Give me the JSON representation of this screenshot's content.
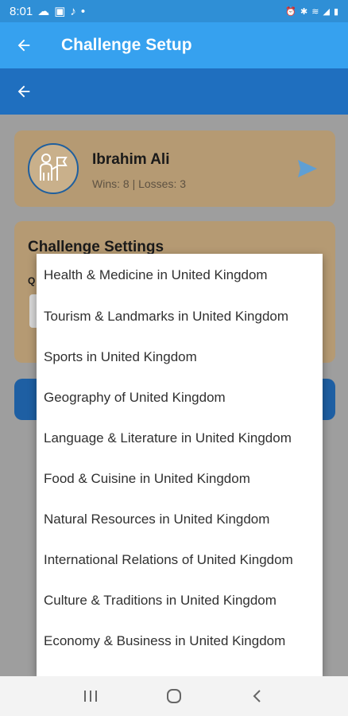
{
  "status": {
    "time": "8:01",
    "left_icons": [
      "cloud-icon",
      "image-icon",
      "music-icon",
      "dot-icon"
    ],
    "right_icons": [
      "alarm-icon",
      "bluetooth-icon",
      "wifi-icon",
      "signal-icon",
      "battery-icon"
    ]
  },
  "app_bar": {
    "title": "Challenge Setup"
  },
  "player": {
    "name": "Ibrahim Ali",
    "stats": "Wins: 8 | Losses: 3"
  },
  "settings": {
    "title": "Challenge Settings",
    "question_label": "Q"
  },
  "dropdown": {
    "items": [
      "Health & Medicine in United Kingdom",
      "Tourism & Landmarks in United Kingdom",
      "Sports in United Kingdom",
      "Geography of United Kingdom",
      "Language & Literature in United Kingdom",
      "Food & Cuisine in United Kingdom",
      "Natural Resources in United Kingdom",
      "International Relations of United Kingdom",
      "Culture & Traditions in United Kingdom",
      "Economy & Business in United Kingdom"
    ]
  },
  "colors": {
    "app_bar": "#36a1ef",
    "sub_bar": "#1f6fbf",
    "card": "#b59a73",
    "button": "#1e5fa3"
  }
}
